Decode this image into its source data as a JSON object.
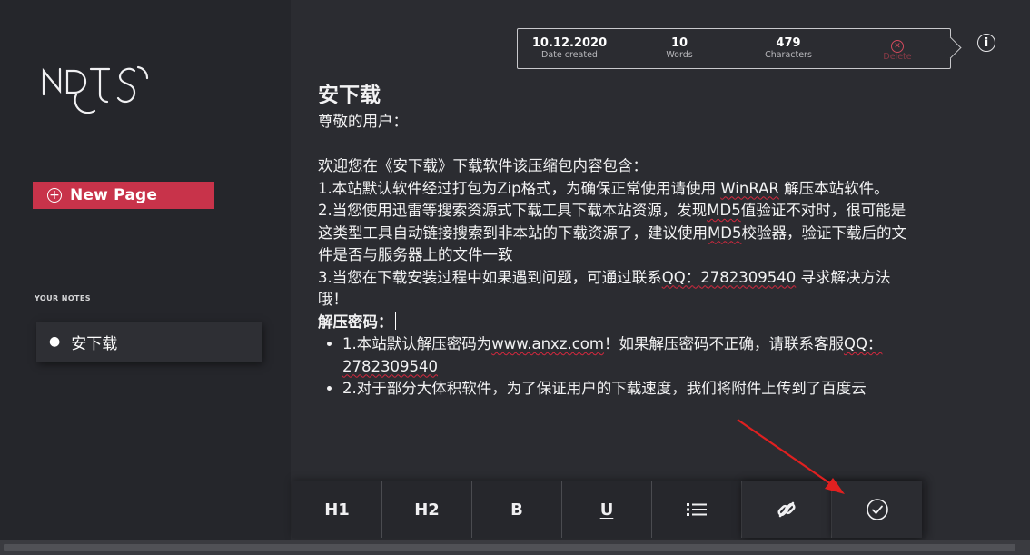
{
  "sidebar": {
    "logo_text": "NDTS",
    "new_page_label": "New Page",
    "section_title": "YOUR NOTES",
    "notes": [
      {
        "title": "安下载"
      }
    ]
  },
  "meta": {
    "date_value": "10.12.2020",
    "date_label": "Date created",
    "words_value": "10",
    "words_label": "Words",
    "chars_value": "479",
    "chars_label": "Characters",
    "delete_label": "Delete"
  },
  "editor": {
    "title": "安下载",
    "line1": "尊敬的用户：",
    "line2": "欢迎您在《安下载》下载软件该压缩包内容包含：",
    "line3a": "1.本站默认软件经过打包为Zip格式，为确保正常使用请使用 ",
    "line3b": "WinRAR",
    "line3c": " 解压本站软件。",
    "line4a": "2.当您使用迅雷等搜索资源式下载工具下载本站资源，发现",
    "line4b": "MD5",
    "line4c": "值验证不对时，很可能是这类型工具自动链接搜索到非本站的下载资源了，建议使用",
    "line4d": "MD5",
    "line4e": "校验器，验证下载后的文件是否与服务器上的文件一致",
    "line5a": "3.当您在下载安装过程中如果遇到问题，可通过联系",
    "line5b": "QQ：2782309540",
    "line5c": " 寻求解决方法哦！",
    "line6": "解压密码：",
    "bullet1a": "1.本站默认解压密码为",
    "bullet1b": "www.anxz.com",
    "bullet1c": "！如果解压密码不正确，请联系客服",
    "bullet1d": "QQ：2782309540",
    "bullet2": "2.对于部分大体积软件，为了保证用户的下载速度，我们将附件上传到了百度云"
  },
  "toolbar": {
    "h1": "H1",
    "h2": "H2",
    "bold": "B",
    "underline": "U",
    "list_icon": "list-icon",
    "link_icon": "link-icon",
    "check_icon": "check-circle-icon"
  },
  "colors": {
    "accent": "#c8334a",
    "background": "#2b2c31",
    "sidebar": "#25262b",
    "annotation_arrow": "#e02020"
  }
}
